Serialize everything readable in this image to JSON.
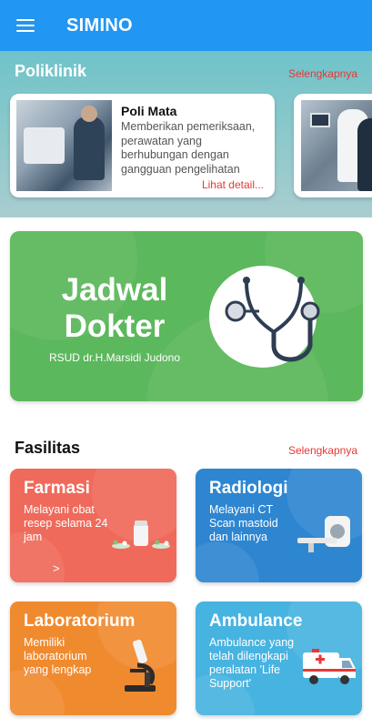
{
  "app": {
    "title": "SIMINO"
  },
  "poliklinik": {
    "heading": "Poliklinik",
    "more_label": "Selengkapnya",
    "cards": [
      {
        "name": "Poli Mata",
        "description": "Memberikan pemeriksaan, perawatan yang berhubungan dengan gangguan pengelihatan",
        "link": "Lihat detail..."
      }
    ]
  },
  "jadwal": {
    "title_line1": "Jadwal",
    "title_line2": "Dokter",
    "subtitle": "RSUD dr.H.Marsidi Judono"
  },
  "fasilitas": {
    "heading": "Fasilitas",
    "more_label": "Selengkapnya",
    "items": [
      {
        "title": "Farmasi",
        "description": "Melayani obat resep selama 24 jam",
        "chevron": ">"
      },
      {
        "title": "Radiologi",
        "description": "Melayani CT Scan mastoid dan lainnya"
      },
      {
        "title": "Laboratorium",
        "description": "Memiliki laboratorium yang lengkap"
      },
      {
        "title": "Ambulance",
        "description": "Ambulance yang telah dilengkapi peralatan 'Life Support'"
      }
    ]
  },
  "colors": {
    "app_bar": "#2196f3",
    "link_red": "#e53935",
    "jadwal_green": "#5cb85c",
    "farmasi": "#ef6a5b",
    "radiologi": "#2e86d1",
    "laboratorium": "#f08a2f",
    "ambulance": "#47b3e0"
  },
  "icons": [
    "menu-icon",
    "stethoscope-icon",
    "medicine-bottle-icon",
    "ct-scanner-icon",
    "microscope-icon",
    "ambulance-icon",
    "chevron-right-icon"
  ]
}
